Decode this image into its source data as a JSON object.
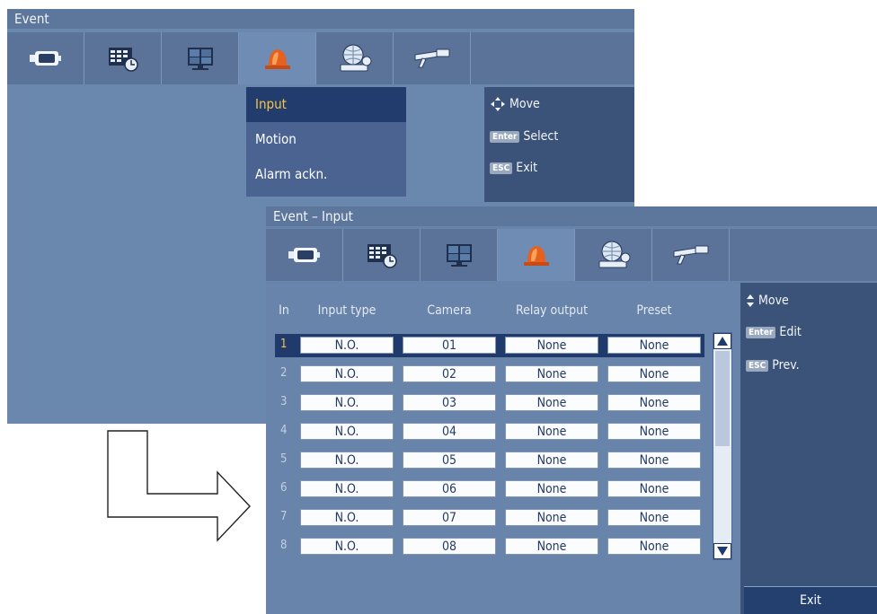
{
  "event_window": {
    "title": "Event",
    "menu": [
      {
        "label": "Input",
        "selected": true
      },
      {
        "label": "Motion",
        "selected": false
      },
      {
        "label": "Alarm ackn.",
        "selected": false
      }
    ],
    "help": {
      "move": "Move",
      "enter_key": "Enter",
      "enter_action": "Select",
      "esc_key": "ESC",
      "esc_action": "Exit"
    }
  },
  "tab_icons": [
    "camera-icon",
    "schedule-icon",
    "monitor-icon",
    "alarm-light-icon",
    "network-icon",
    "tools-icon"
  ],
  "input_window": {
    "title": "Event – Input",
    "columns": [
      "In",
      "Input type",
      "Camera",
      "Relay output",
      "Preset"
    ],
    "rows": [
      {
        "in": "1",
        "input_type": "N.O.",
        "camera": "01",
        "relay": "None",
        "preset": "None",
        "selected": true
      },
      {
        "in": "2",
        "input_type": "N.O.",
        "camera": "02",
        "relay": "None",
        "preset": "None"
      },
      {
        "in": "3",
        "input_type": "N.O.",
        "camera": "03",
        "relay": "None",
        "preset": "None"
      },
      {
        "in": "4",
        "input_type": "N.O.",
        "camera": "04",
        "relay": "None",
        "preset": "None"
      },
      {
        "in": "5",
        "input_type": "N.O.",
        "camera": "05",
        "relay": "None",
        "preset": "None"
      },
      {
        "in": "6",
        "input_type": "N.O.",
        "camera": "06",
        "relay": "None",
        "preset": "None"
      },
      {
        "in": "7",
        "input_type": "N.O.",
        "camera": "07",
        "relay": "None",
        "preset": "None"
      },
      {
        "in": "8",
        "input_type": "N.O.",
        "camera": "08",
        "relay": "None",
        "preset": "None"
      }
    ],
    "help": {
      "move": "Move",
      "enter_key": "Enter",
      "enter_action": "Edit",
      "esc_key": "ESC",
      "esc_action": "Prev."
    },
    "exit_label": "Exit"
  },
  "colors": {
    "panel": "#6a87ad",
    "selection": "#223c6e",
    "highlight_text": "#f4c64a",
    "help_panel": "#3c5379"
  }
}
